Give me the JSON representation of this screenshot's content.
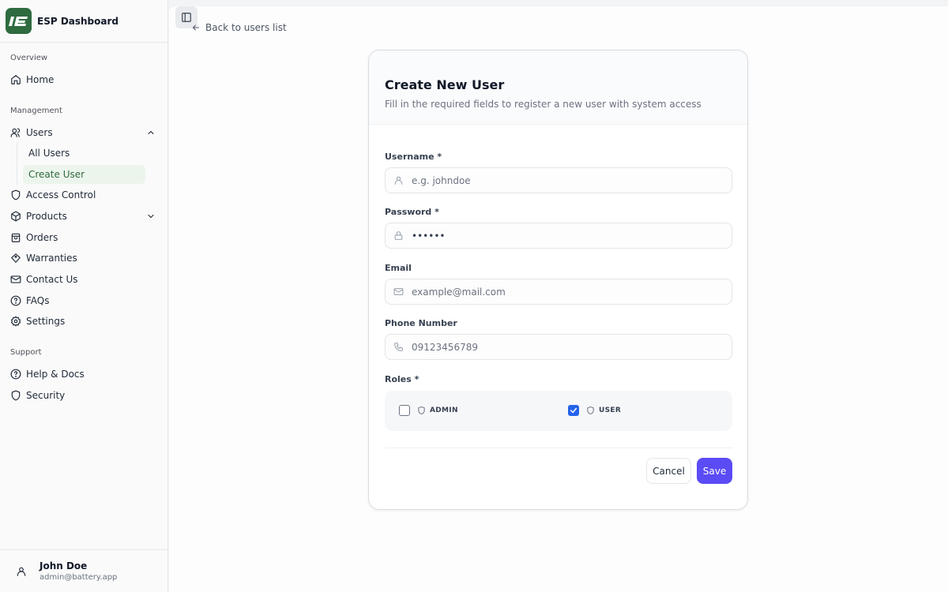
{
  "brand": {
    "title": "ESP Dashboard",
    "logo_text": "IE"
  },
  "sidebar": {
    "sections": [
      {
        "label": "Overview"
      },
      {
        "label": "Management"
      },
      {
        "label": "Support"
      }
    ],
    "items": [
      {
        "label": "Home",
        "icon": "home-icon"
      },
      {
        "label": "Users",
        "icon": "users-icon",
        "expanded": true
      },
      {
        "label": "Access Control",
        "icon": "shield-icon"
      },
      {
        "label": "Products",
        "icon": "box-icon",
        "expanded": false
      },
      {
        "label": "Orders",
        "icon": "shopping-bag-icon"
      },
      {
        "label": "Warranties",
        "icon": "tag-icon"
      },
      {
        "label": "Contact Us",
        "icon": "mail-icon"
      },
      {
        "label": "FAQs",
        "icon": "help-circle-icon"
      },
      {
        "label": "Settings",
        "icon": "gear-icon"
      },
      {
        "label": "Help & Docs",
        "icon": "help-circle-icon"
      },
      {
        "label": "Security",
        "icon": "shield-icon"
      }
    ],
    "users_subitems": [
      {
        "label": "All Users",
        "active": false
      },
      {
        "label": "Create User",
        "active": true
      }
    ]
  },
  "user": {
    "name": "John Doe",
    "email": "admin@battery.app"
  },
  "main": {
    "back_link": "Back to users list"
  },
  "form": {
    "title": "Create New User",
    "subtitle": "Fill in the required fields to register a new user with system access",
    "username": {
      "label": "Username *",
      "placeholder": "e.g. johndoe",
      "value": ""
    },
    "password": {
      "label": "Password *",
      "value": "••••••"
    },
    "email": {
      "label": "Email",
      "placeholder": "example@mail.com",
      "value": ""
    },
    "phone": {
      "label": "Phone Number",
      "placeholder": "09123456789",
      "value": ""
    },
    "roles": {
      "label": "Roles *",
      "options": [
        {
          "label": "ADMIN",
          "checked": false
        },
        {
          "label": "USER",
          "checked": true
        }
      ]
    },
    "cancel_label": "Cancel",
    "save_label": "Save"
  },
  "colors": {
    "brand_green": "#2e6b3f",
    "active_nav_bg": "#ecf5ec",
    "primary_button": "#5b4bf5",
    "checkbox_checked": "#2563eb"
  }
}
